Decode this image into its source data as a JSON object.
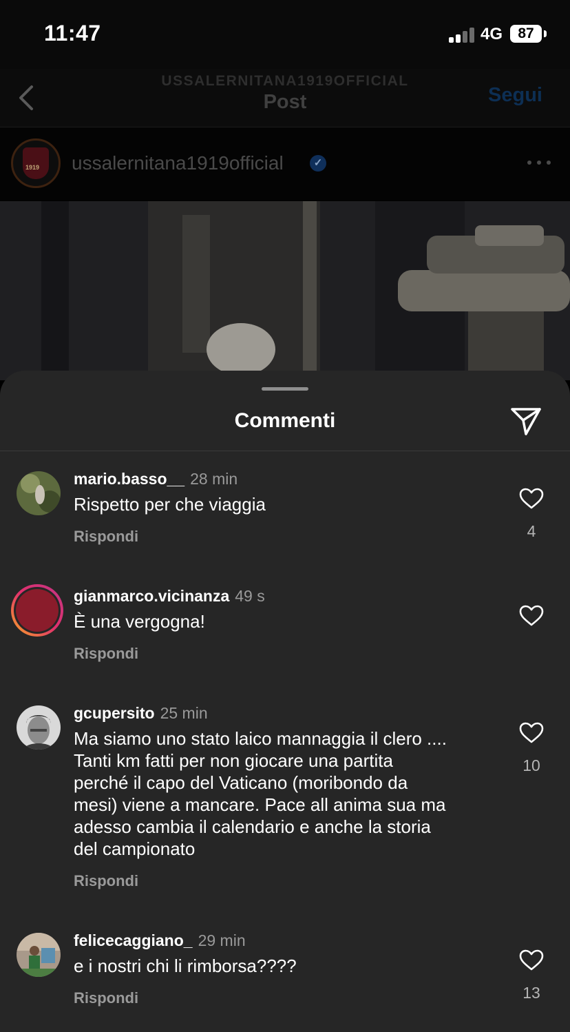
{
  "status_bar": {
    "time": "11:47",
    "network": "4G",
    "battery": "87"
  },
  "header": {
    "account_caps": "USSALERNITANA1919OFFICIAL",
    "title": "Post",
    "follow_label": "Segui"
  },
  "post": {
    "author": "ussalernitana1919official",
    "verified": true,
    "avatar_text": "1919"
  },
  "sheet": {
    "title": "Commenti"
  },
  "comments": [
    {
      "username": "mario.basso__",
      "time": "28 min",
      "text": "Rispetto per che viaggia",
      "reply_label": "Rispondi",
      "likes": "4"
    },
    {
      "username": "gianmarco.vicinanza",
      "time": "49 s",
      "text": "È una vergogna!",
      "reply_label": "Rispondi",
      "likes": ""
    },
    {
      "username": "gcupersito",
      "time": "25 min",
      "text_lines": [
        "Ma siamo uno stato laico mannaggia il clero ....",
        "Tanti km fatti per non giocare una partita",
        "perché il capo del Vaticano (moribondo da",
        "mesi) viene a mancare. Pace all anima sua ma",
        "adesso cambia il calendario e anche la storia",
        "del campionato"
      ],
      "reply_label": "Rispondi",
      "likes": "10"
    },
    {
      "username": "felicecaggiano_",
      "time": "29 min",
      "text": "e i nostri chi li rimborsa????",
      "reply_label": "Rispondi",
      "likes": "13"
    }
  ],
  "icons": {
    "back": "chevron-left-icon",
    "verified": "verified-badge-icon",
    "more": "more-dots-icon",
    "share": "send-icon",
    "like": "heart-icon"
  },
  "colors": {
    "sheet_bg": "#262626",
    "follow": "#0d2f54",
    "story_ring": "#e1306c"
  }
}
